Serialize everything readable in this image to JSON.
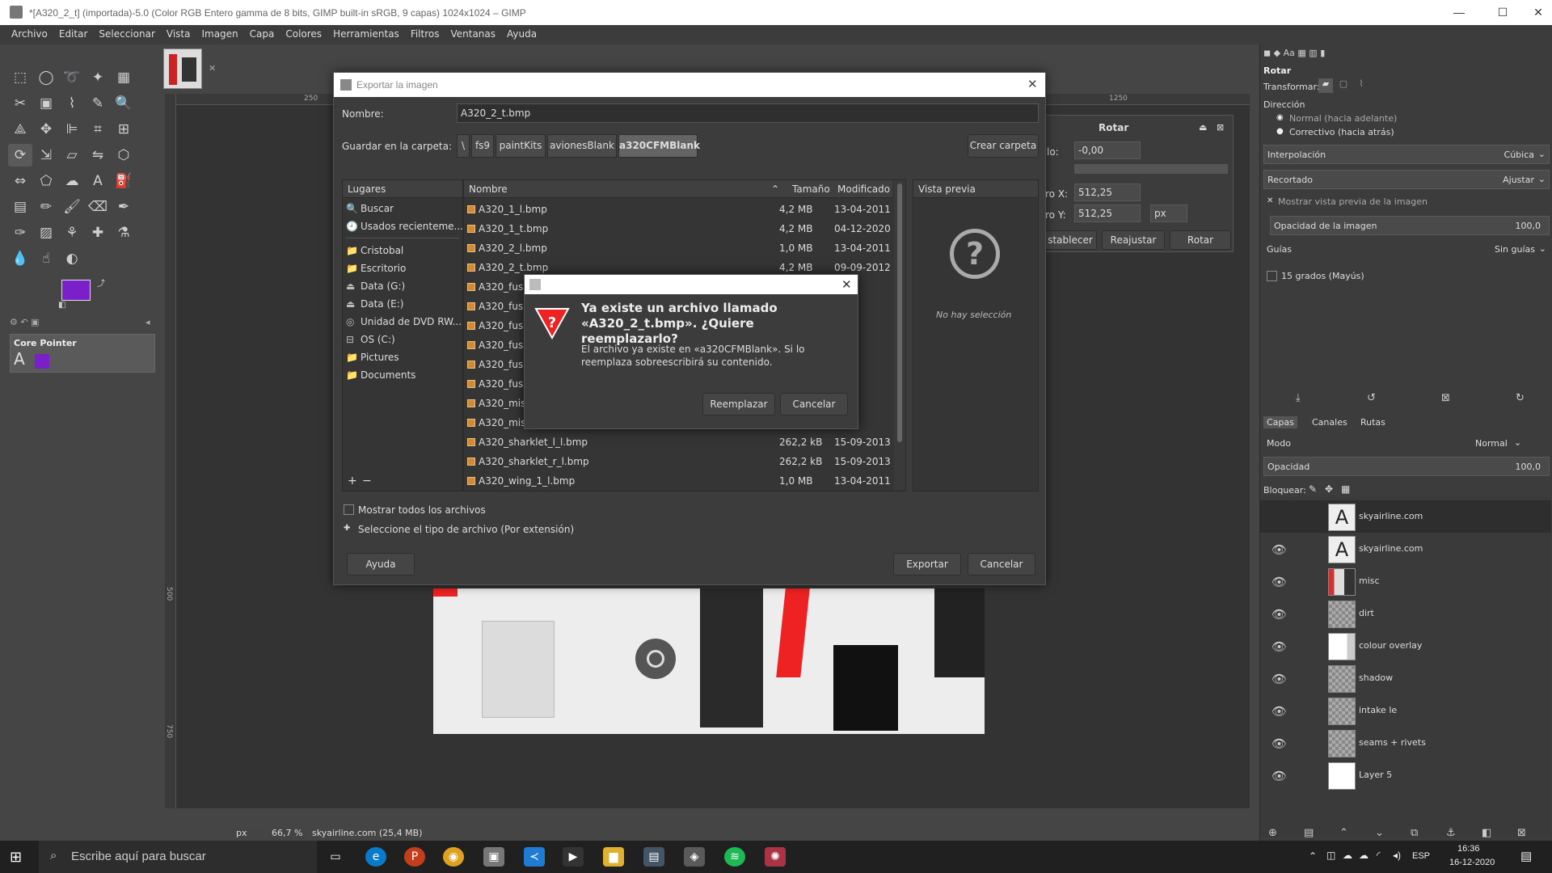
{
  "window": {
    "title": "*[A320_2_t] (importada)-5.0 (Color RGB Entero gamma de 8 bits, GIMP built-in sRGB, 9 capas) 1024x1024 – GIMP",
    "minimize": "—",
    "maximize": "☐",
    "close": "✕"
  },
  "menu": [
    "Archivo",
    "Editar",
    "Seleccionar",
    "Vista",
    "Imagen",
    "Capa",
    "Colores",
    "Herramientas",
    "Filtros",
    "Ventanas",
    "Ayuda"
  ],
  "colors": {
    "foreground": "#7a1fc9",
    "background": "#2a2a2a",
    "accent": "#5a5a5a"
  },
  "tool_options": {
    "title": "Core Pointer"
  },
  "rulers": {
    "h1": "250",
    "h2": "1250",
    "h3": "500",
    "h4": "750"
  },
  "status": {
    "unit": "px",
    "zoom": "66,7 %",
    "info": "skyairline.com (25,4 MB)"
  },
  "export": {
    "title": "Exportar la imagen",
    "name_label": "Nombre:",
    "name_value": "A320_2_t.bmp",
    "folder_label": "Guardar en la carpeta:",
    "crumbs": [
      "\\",
      "fs9",
      "paintKits",
      "avionesBlank",
      "a320CFMBlank"
    ],
    "create_folder": "Crear carpeta",
    "places_header": "Lugares",
    "places": [
      {
        "icon": "🔍",
        "label": "Buscar"
      },
      {
        "icon": "🕘",
        "label": "Usados recienteme..."
      },
      {
        "icon": "📁",
        "label": "Cristobal"
      },
      {
        "icon": "📁",
        "label": "Escritorio"
      },
      {
        "icon": "⏏",
        "label": "Data (G:)"
      },
      {
        "icon": "⏏",
        "label": "Data (E:)"
      },
      {
        "icon": "◎",
        "label": "Unidad de DVD RW..."
      },
      {
        "icon": "⊟",
        "label": "OS (C:)"
      },
      {
        "icon": "📁",
        "label": "Pictures"
      },
      {
        "icon": "📁",
        "label": "Documents"
      }
    ],
    "places_add": "+",
    "places_remove": "−",
    "col_name": "Nombre",
    "col_size": "Tamaño",
    "col_modified": "Modificado",
    "files": [
      {
        "name": "A320_1_l.bmp",
        "size": "4,2 MB",
        "date": "13-04-2011"
      },
      {
        "name": "A320_1_t.bmp",
        "size": "4,2 MB",
        "date": "04-12-2020"
      },
      {
        "name": "A320_2_l.bmp",
        "size": "1,0 MB",
        "date": "13-04-2011"
      },
      {
        "name": "A320_2_t.bmp",
        "size": "4,2 MB",
        "date": "09-09-2012"
      },
      {
        "name": "A320_fus",
        "size": "",
        "date": "2011"
      },
      {
        "name": "A320_fus",
        "size": "",
        "date": "2020"
      },
      {
        "name": "A320_fus",
        "size": "",
        "date": "2011"
      },
      {
        "name": "A320_fus",
        "size": "",
        "date": "2020"
      },
      {
        "name": "A320_fus",
        "size": "",
        "date": "2011"
      },
      {
        "name": "A320_fus",
        "size": "",
        "date": "2020"
      },
      {
        "name": "A320_mis",
        "size": "",
        "date": "2011"
      },
      {
        "name": "A320_mis",
        "size": "",
        "date": "2012"
      },
      {
        "name": "A320_sharklet_l_l.bmp",
        "size": "262,2 kB",
        "date": "15-09-2013"
      },
      {
        "name": "A320_sharklet_r_l.bmp",
        "size": "262,2 kB",
        "date": "15-09-2013"
      },
      {
        "name": "A320_wing_1_l.bmp",
        "size": "1,0 MB",
        "date": "13-04-2011"
      }
    ],
    "preview_header": "Vista previa",
    "preview_empty": "No hay selección",
    "show_all": "Mostrar todos los archivos",
    "file_type": "Seleccione el tipo de archivo (Por extensión)",
    "help": "Ayuda",
    "export_btn": "Exportar",
    "cancel_btn": "Cancelar"
  },
  "confirm": {
    "heading": "Ya existe un archivo llamado «A320_2_t.bmp». ¿Quiere reemplazarlo?",
    "body": "El archivo ya existe en «a320CFMBlank». Si lo reemplaza sobreescribirá su contenido.",
    "replace": "Reemplazar",
    "cancel": "Cancelar"
  },
  "rotate": {
    "title": "Rotar",
    "angle_label": "lo:",
    "angle": "-0,00",
    "cx_label": "ro X:",
    "cx": "512,25",
    "cy_label": "ro Y:",
    "cy": "512,25",
    "unit": "px",
    "reset": "stablecer",
    "readjust": "Reajustar",
    "rotate": "Rotar"
  },
  "tool_panel": {
    "title": "Rotar",
    "transform_label": "Transformar:",
    "direction_label": "Dirección",
    "dir_normal": "Normal (hacia adelante)",
    "dir_corrective": "Correctivo (hacia atrás)",
    "interp_label": "Interpolación",
    "interp_value": "Cúbica",
    "clip_label": "Recortado",
    "clip_value": "Ajustar",
    "show_preview": "Mostrar vista previa de la imagen",
    "opacity_label": "Opacidad de la imagen",
    "opacity_value": "100,0",
    "guides_label": "Guías",
    "guides_value": "Sin guías",
    "snap": "15 grados (Mayús)"
  },
  "layers_panel": {
    "tab_layers": "Capas",
    "tab_channels": "Canales",
    "tab_paths": "Rutas",
    "mode_label": "Modo",
    "mode_value": "Normal",
    "opacity_label": "Opacidad",
    "opacity_value": "100,0",
    "lock_label": "Bloquear:",
    "layers": [
      "skyairline.com",
      "skyairline.com",
      "misc",
      "dirt",
      "colour overlay",
      "shadow",
      "intake le",
      "seams + rivets",
      "Layer 5"
    ]
  },
  "taskbar": {
    "search": "Escribe aquí para buscar",
    "lang": "ESP",
    "time": "16:36",
    "date": "16-12-2020"
  }
}
